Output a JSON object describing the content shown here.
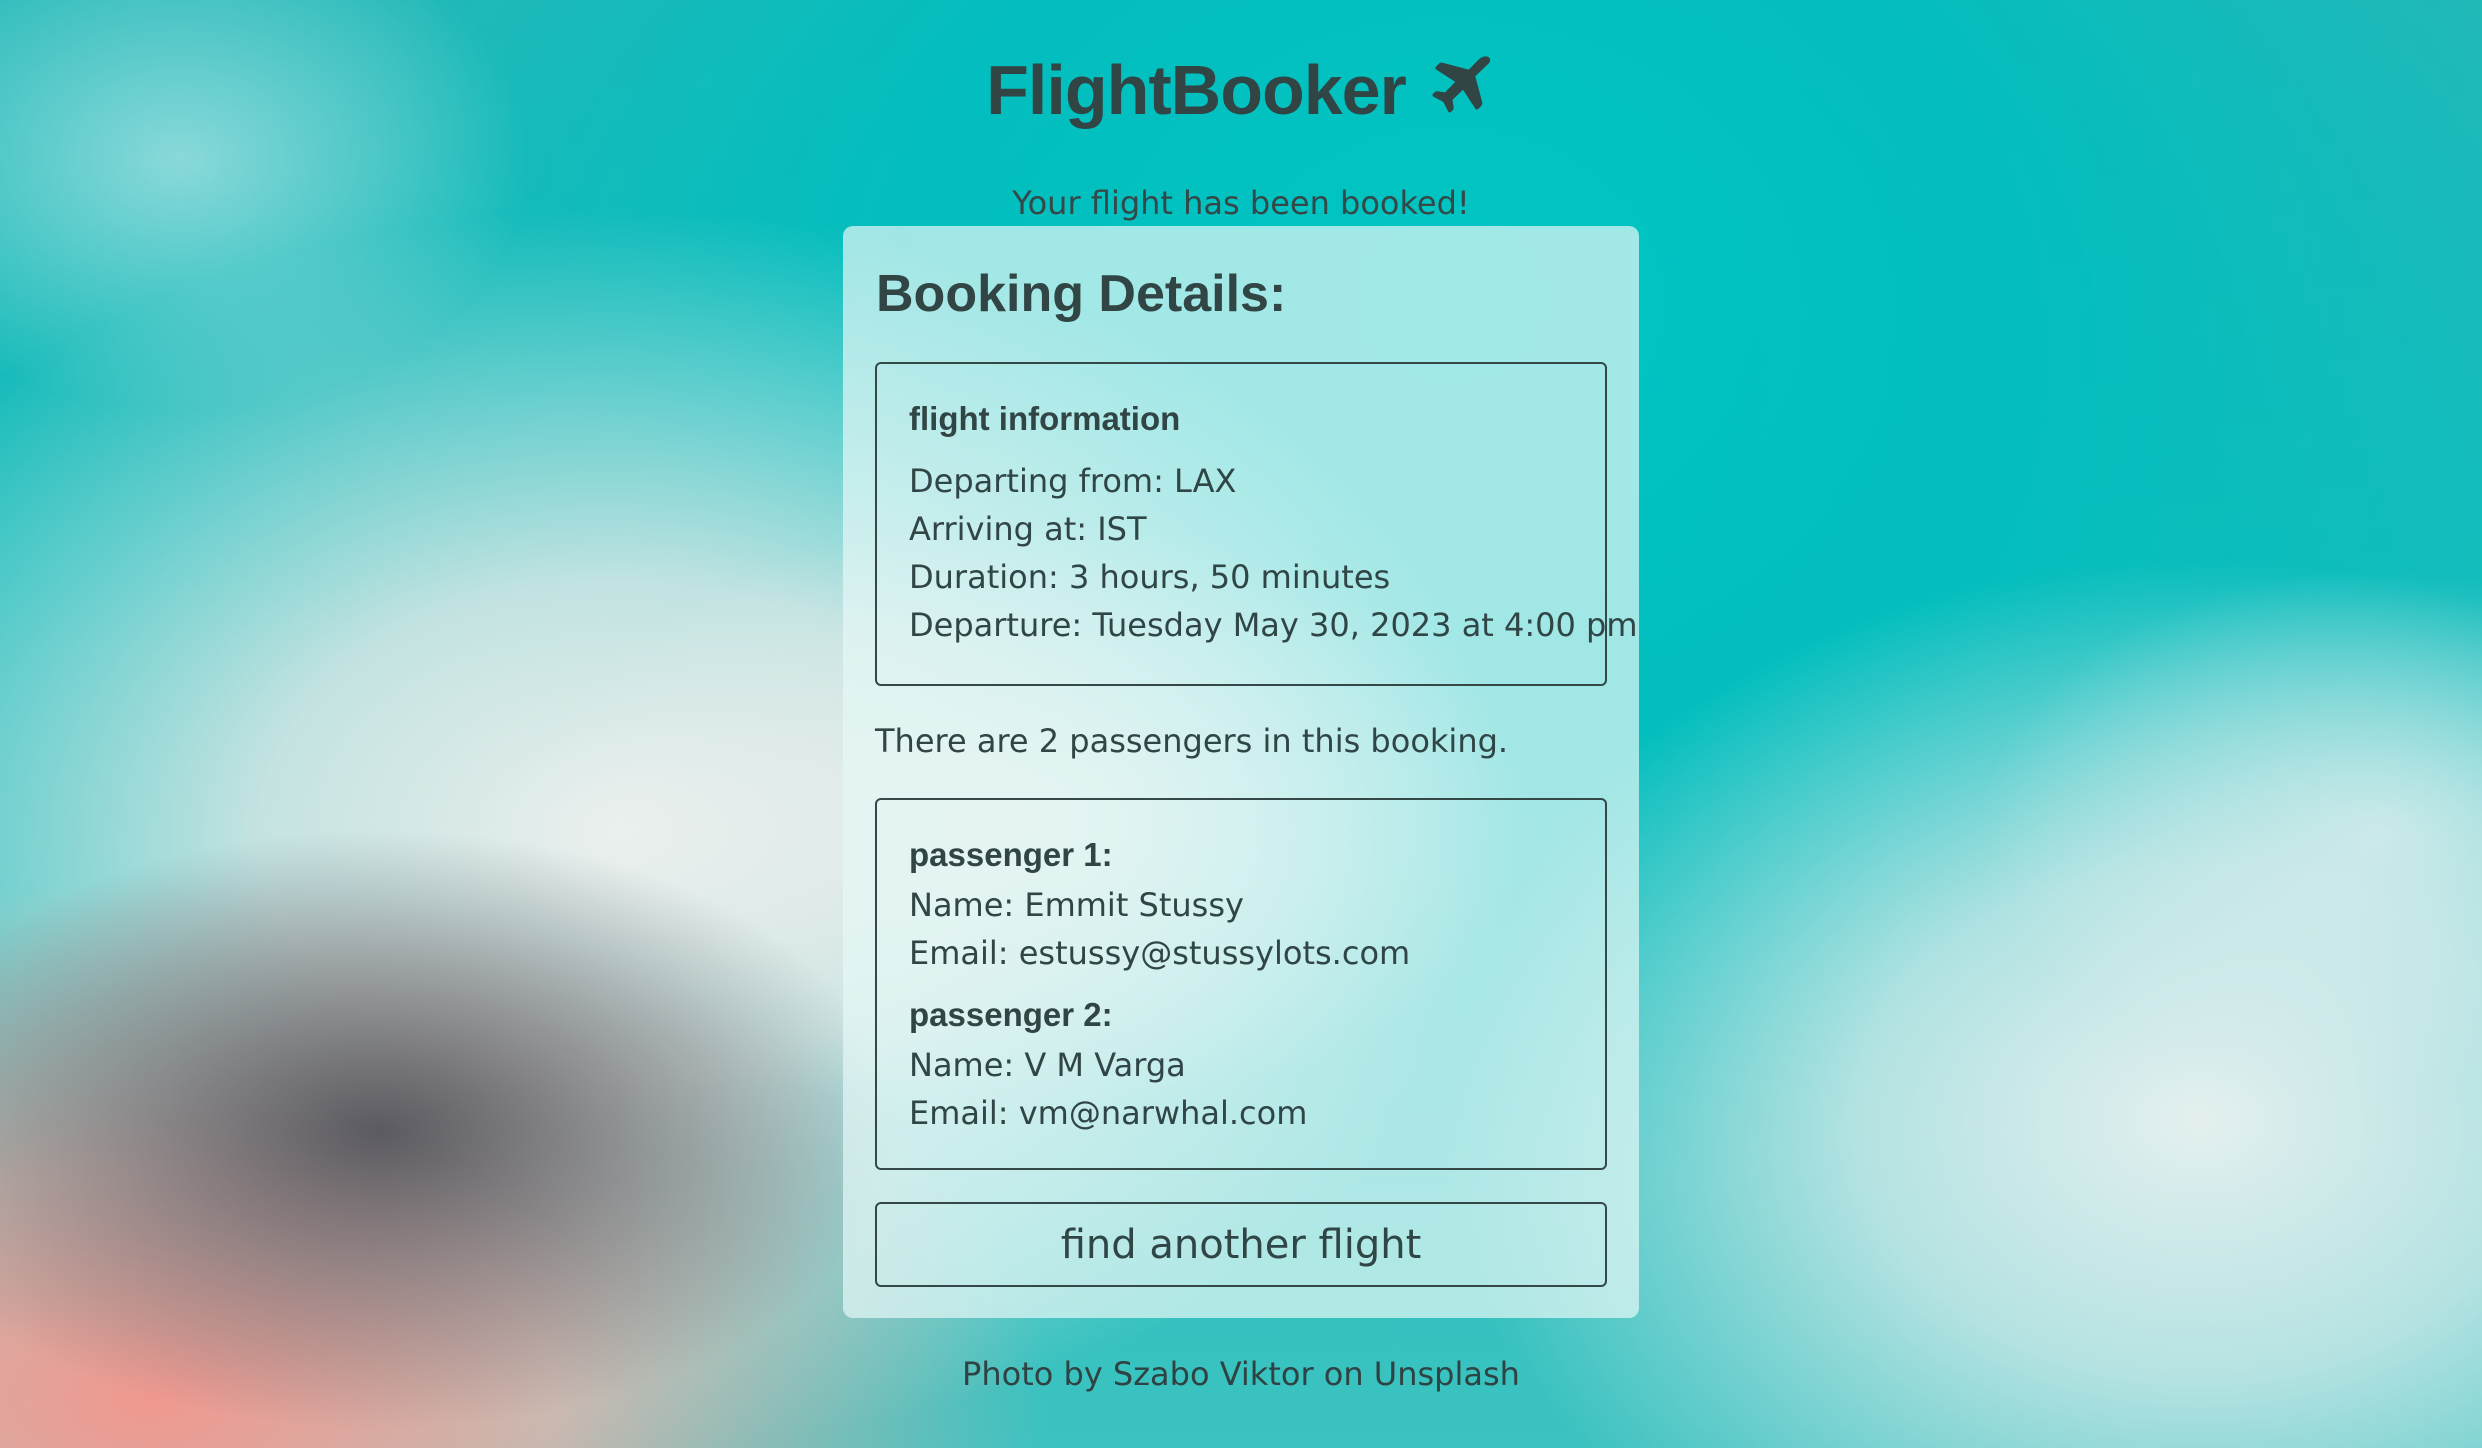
{
  "header": {
    "app_title": "FlightBooker",
    "icon": "airplane-icon"
  },
  "status": {
    "message": "Your flight has been booked!"
  },
  "booking": {
    "title": "Booking Details:",
    "flight": {
      "heading": "flight information",
      "departing": "Departing from: LAX",
      "arriving": "Arriving at: IST",
      "duration": "Duration: 3 hours, 50 minutes",
      "departure": "Departure: Tuesday May 30, 2023 at 4:00 pm"
    },
    "passenger_summary": "There are 2 passengers in this booking.",
    "passengers": [
      {
        "heading": "passenger 1:",
        "name": "Name: Emmit Stussy",
        "email": "Email: estussy@stussylots.com"
      },
      {
        "heading": "passenger 2:",
        "name": "Name: V M Varga",
        "email": "Email: vm@narwhal.com"
      }
    ],
    "find_another_label": "find another flight"
  },
  "footer": {
    "credit": "Photo by Szabo Viktor on Unsplash"
  },
  "colors": {
    "text": "#304545",
    "sky": "#12bdbc",
    "card": "#e6f8f6"
  }
}
